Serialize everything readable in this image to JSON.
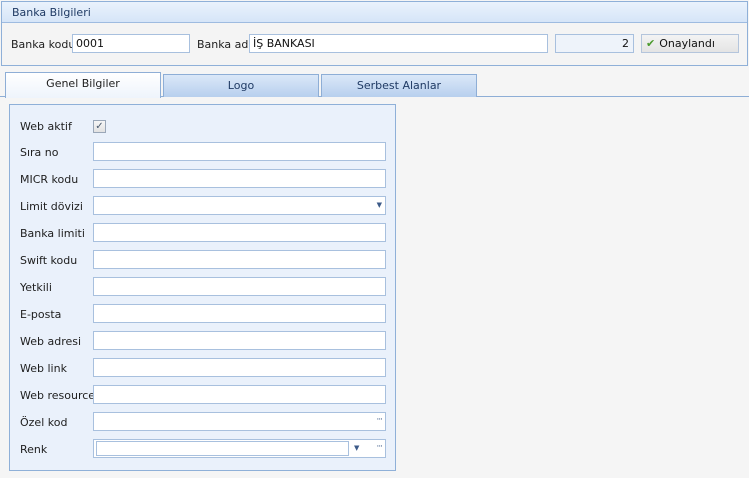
{
  "group": {
    "title": "Banka Bilgileri"
  },
  "header": {
    "bank_code_label": "Banka kodu",
    "bank_code_value": "0001",
    "bank_name_label": "Banka adı",
    "bank_name_value": "İŞ BANKASI",
    "count_value": "2",
    "status_label": "Onaylandı",
    "status_icon": "check-icon"
  },
  "tabs": [
    {
      "label": "Genel Bilgiler",
      "active": true
    },
    {
      "label": "Logo",
      "active": false
    },
    {
      "label": "Serbest Alanlar",
      "active": false
    }
  ],
  "form": {
    "web_aktif_label": "Web aktif",
    "web_aktif_checked": true,
    "sira_no_label": "Sıra no",
    "micr_label": "MICR kodu",
    "limit_doviz_label": "Limit dövizi",
    "banka_limiti_label": "Banka limiti",
    "swift_label": "Swift kodu",
    "yetkili_label": "Yetkili",
    "eposta_label": "E-posta",
    "web_adresi_label": "Web adresi",
    "web_link_label": "Web link",
    "web_resource_label": "Web resource",
    "ozel_kod_label": "Özel kod",
    "renk_label": "Renk"
  },
  "icons": {
    "dropdown": "dropdown-arrow-icon",
    "ellipsis": "ellipsis-icon",
    "checkmark": "checkmark-icon"
  },
  "colors": {
    "accent": "#8fb0d8",
    "title_text": "#1f3a64",
    "panel_bg": "#eaf1fb",
    "status_check": "#4b9a2d"
  }
}
